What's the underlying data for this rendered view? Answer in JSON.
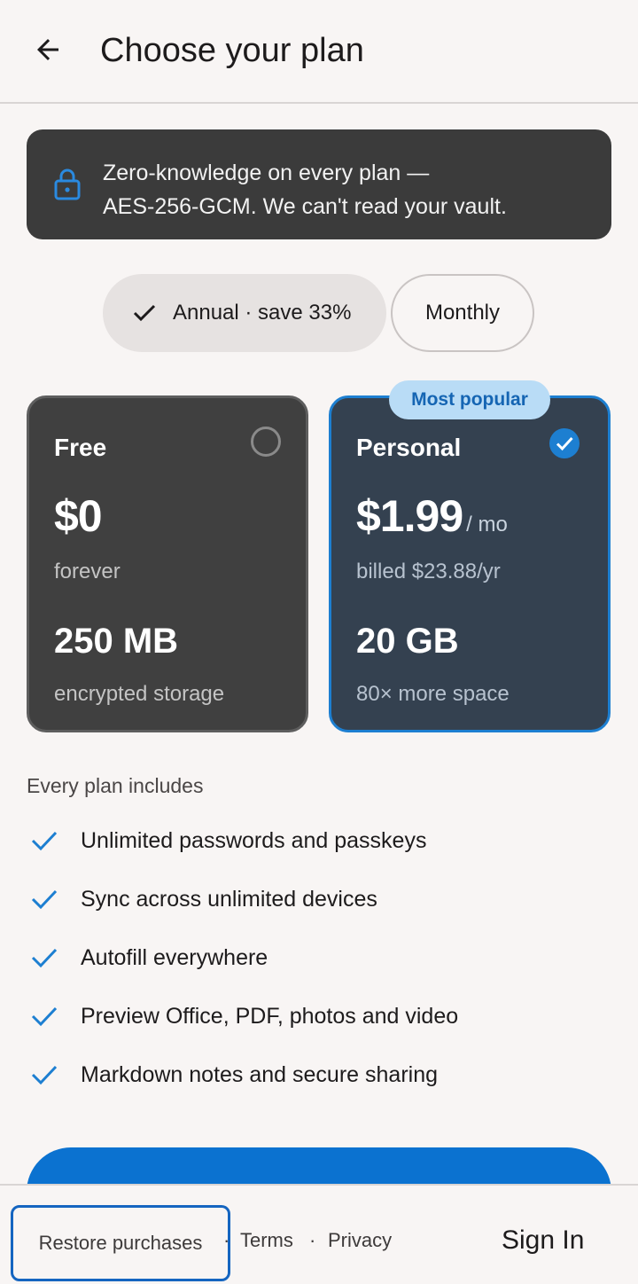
{
  "header": {
    "title": "Choose your plan",
    "back_icon": "arrow-back-icon"
  },
  "banner": {
    "icon": "lock-icon",
    "line1": "Zero-knowledge on every plan —",
    "line2": "AES-256-GCM. We can't read your vault."
  },
  "billing_toggle": {
    "annual_label": "Annual · save 33%",
    "monthly_label": "Monthly",
    "selected": "annual"
  },
  "plans": [
    {
      "name": "Free",
      "price": "$0",
      "period": "",
      "subtitle": "forever",
      "storage": "250 MB",
      "storage_note": "encrypted storage",
      "selected": false
    },
    {
      "name": "Personal",
      "price": "$1.99",
      "period": "/ mo",
      "subtitle": "billed $23.88/yr",
      "storage": "20 GB",
      "storage_note": "80× more space",
      "badge": "Most popular",
      "selected": true
    }
  ],
  "includes": {
    "heading": "Every plan includes",
    "items": [
      "Unlimited passwords and passkeys",
      "Sync across unlimited devices",
      "Autofill everywhere",
      "Preview Office, PDF, photos and video",
      "Markdown notes and secure sharing"
    ]
  },
  "footer": {
    "restore": "Restore purchases",
    "separator": "·",
    "terms": "Terms",
    "privacy": "Privacy",
    "sign_in": "Sign In"
  },
  "colors": {
    "accent": "#0b72d0",
    "card_dark": "#404040",
    "card_selected": "#344150",
    "banner_bg": "#3b3b3b"
  }
}
